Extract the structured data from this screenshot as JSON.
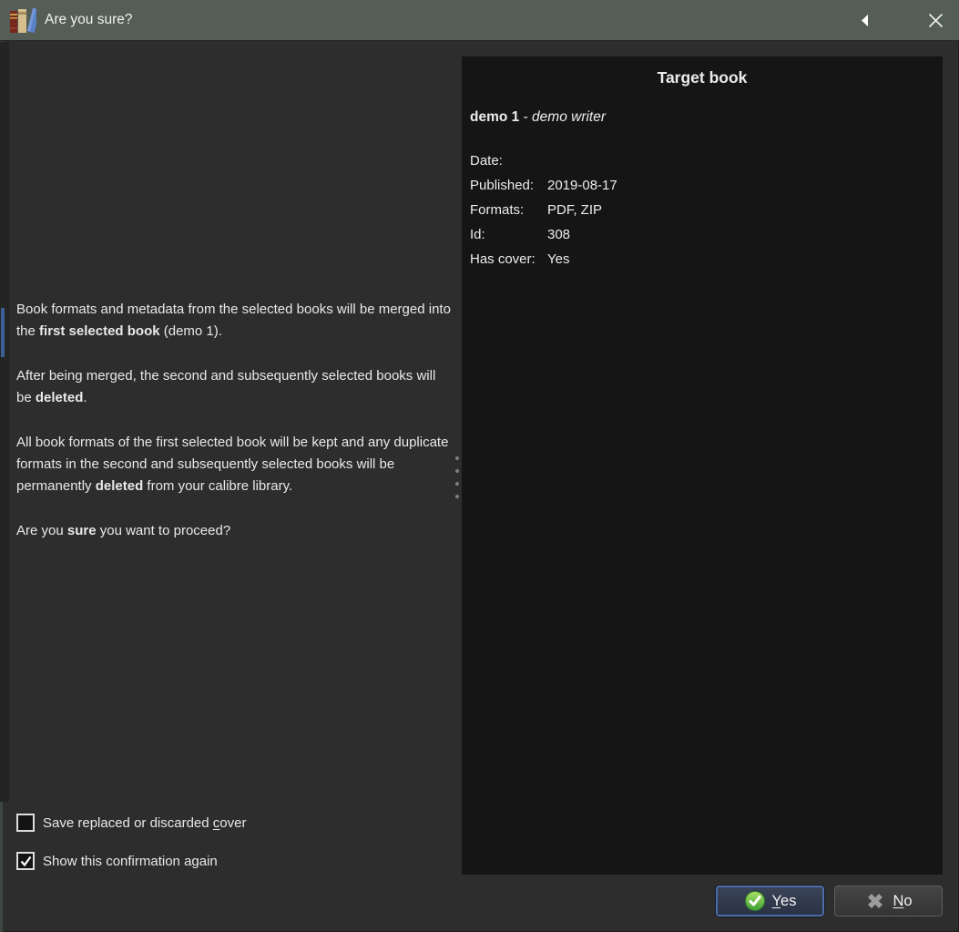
{
  "window": {
    "title": "Are you sure?"
  },
  "icons": {
    "app_icon": "calibre-books-icon",
    "titlebar_arrow": "collapse-left-arrow-icon",
    "titlebar_close": "close-icon",
    "yes_icon": "green-check-circle-icon",
    "no_icon": "gray-cross-icon"
  },
  "message": {
    "paragraphs": [
      [
        {
          "t": "Book formats and metadata from the selected books will be merged into the "
        },
        {
          "t": "first selected book",
          "b": 1
        },
        {
          "t": " (demo 1)."
        }
      ],
      [
        {
          "t": "After being merged, the second and subsequently selected books will be "
        },
        {
          "t": "deleted",
          "b": 1
        },
        {
          "t": "."
        }
      ],
      [
        {
          "t": "All book formats of the first selected book will be kept and any duplicate formats in the second and subsequently selected books will be permanently "
        },
        {
          "t": "deleted",
          "b": 1
        },
        {
          "t": " from your calibre library."
        }
      ],
      [
        {
          "t": "Are you "
        },
        {
          "t": "sure",
          "b": 1
        },
        {
          "t": " you want to proceed?"
        }
      ]
    ]
  },
  "target_panel": {
    "title": "Target book",
    "book": [
      {
        "t": "demo 1",
        "b": 1
      },
      {
        "t": " - "
      },
      {
        "t": "demo writer",
        "i": 1
      }
    ],
    "fields": [
      {
        "label": "Date:",
        "value": ""
      },
      {
        "label": "Published:",
        "value": "2019-08-17"
      },
      {
        "label": "Formats:",
        "value": "PDF, ZIP"
      },
      {
        "label": "Id:",
        "value": "308"
      },
      {
        "label": "Has cover:",
        "value": "Yes"
      }
    ]
  },
  "checkboxes": [
    {
      "checked": false,
      "label": [
        {
          "t": "Save replaced or discarded "
        },
        {
          "t": "c",
          "u": 1
        },
        {
          "t": "over"
        }
      ]
    },
    {
      "checked": true,
      "label": [
        {
          "t": "Show this confirmation again"
        }
      ]
    }
  ],
  "buttons": {
    "yes_label": [
      {
        "t": "Y",
        "u": 1
      },
      {
        "t": "es"
      }
    ],
    "no_label": [
      {
        "t": "N",
        "u": 1
      },
      {
        "t": "o"
      }
    ]
  },
  "colors": {
    "titlebar": "#545d56",
    "window_bg": "#2d2d2d",
    "panel_bg": "#151515",
    "text": "#e9e9e9",
    "accent_blue_border": "#4a6da8",
    "scroll_thumb_blue": "#3c5f96",
    "yes_icon_green": "#3e9e35",
    "no_icon_gray": "#9c9c9c"
  }
}
